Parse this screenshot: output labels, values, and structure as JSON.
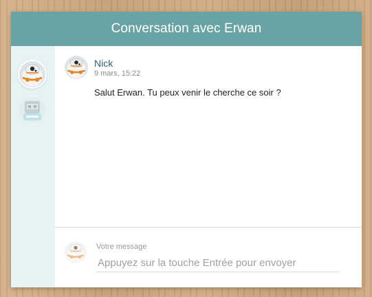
{
  "header": {
    "title": "Conversation avec Erwan"
  },
  "sidebar": {
    "contacts": [
      {
        "icon": "bb8-avatar-icon",
        "active": true
      },
      {
        "icon": "robot-avatar-icon",
        "active": false
      }
    ]
  },
  "messages": [
    {
      "author": "Nick",
      "time": "9 mars, 15:22",
      "text": "Salut Erwan. Tu peux venir le cherche ce soir ?",
      "avatar_icon": "bb8-avatar-icon"
    }
  ],
  "composer": {
    "label": "Votre message",
    "placeholder": "Appuyez sur la touche Entrée pour envoyer",
    "value": "",
    "avatar_icon": "bb8-avatar-icon"
  },
  "colors": {
    "header_bg": "#6aa3a3",
    "sidebar_bg": "#e6f2f3",
    "author_text": "#2f5f6e"
  }
}
